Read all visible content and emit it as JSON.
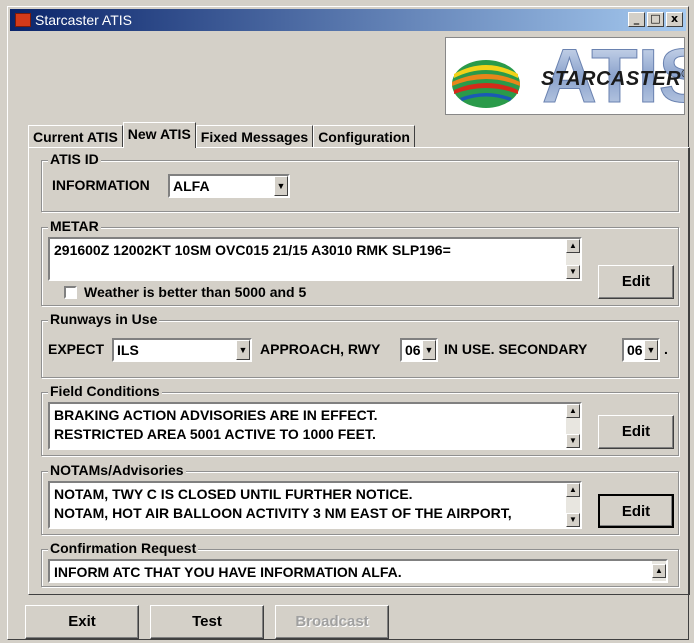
{
  "window": {
    "title": "Starcaster ATIS",
    "minimize": "_",
    "maximize": "□",
    "close": "x"
  },
  "logo": {
    "brand": "STARCASTER",
    "product": "ATIS",
    "registered": "®"
  },
  "tabs": [
    {
      "label": "Current ATIS",
      "active": false
    },
    {
      "label": "New ATIS",
      "active": true
    },
    {
      "label": "Fixed Messages",
      "active": false
    },
    {
      "label": "Configuration",
      "active": false
    }
  ],
  "atis_id": {
    "legend": "ATIS ID",
    "information_label": "INFORMATION",
    "information_value": "ALFA"
  },
  "metar": {
    "legend": "METAR",
    "text": "291600Z 12002KT 10SM OVC015 21/15 A3010 RMK SLP196=",
    "edit_label": "Edit",
    "checkbox_label": "Weather is better than 5000 and 5",
    "checkbox_checked": false
  },
  "runways": {
    "legend": "Runways in Use",
    "expect_label": "EXPECT",
    "approach_value": "ILS",
    "approach_label": "APPROACH, RWY",
    "runway_value": "06",
    "in_use_label": "IN USE. SECONDARY",
    "secondary_value": "06",
    "period": "."
  },
  "field_conditions": {
    "legend": "Field Conditions",
    "lines": [
      "BRAKING ACTION ADVISORIES ARE IN EFFECT.",
      "RESTRICTED AREA 5001 ACTIVE TO 1000 FEET."
    ],
    "edit_label": "Edit"
  },
  "notams": {
    "legend": "NOTAMs/Advisories",
    "lines": [
      "NOTAM, TWY C IS CLOSED UNTIL FURTHER NOTICE.",
      "NOTAM, HOT AIR BALLOON ACTIVITY 3 NM EAST OF THE AIRPORT,"
    ],
    "edit_label": "Edit"
  },
  "confirmation": {
    "legend": "Confirmation Request",
    "text": "INFORM ATC THAT YOU HAVE INFORMATION ALFA."
  },
  "footer": {
    "exit_label": "Exit",
    "test_label": "Test",
    "broadcast_label": "Broadcast",
    "broadcast_enabled": false
  }
}
